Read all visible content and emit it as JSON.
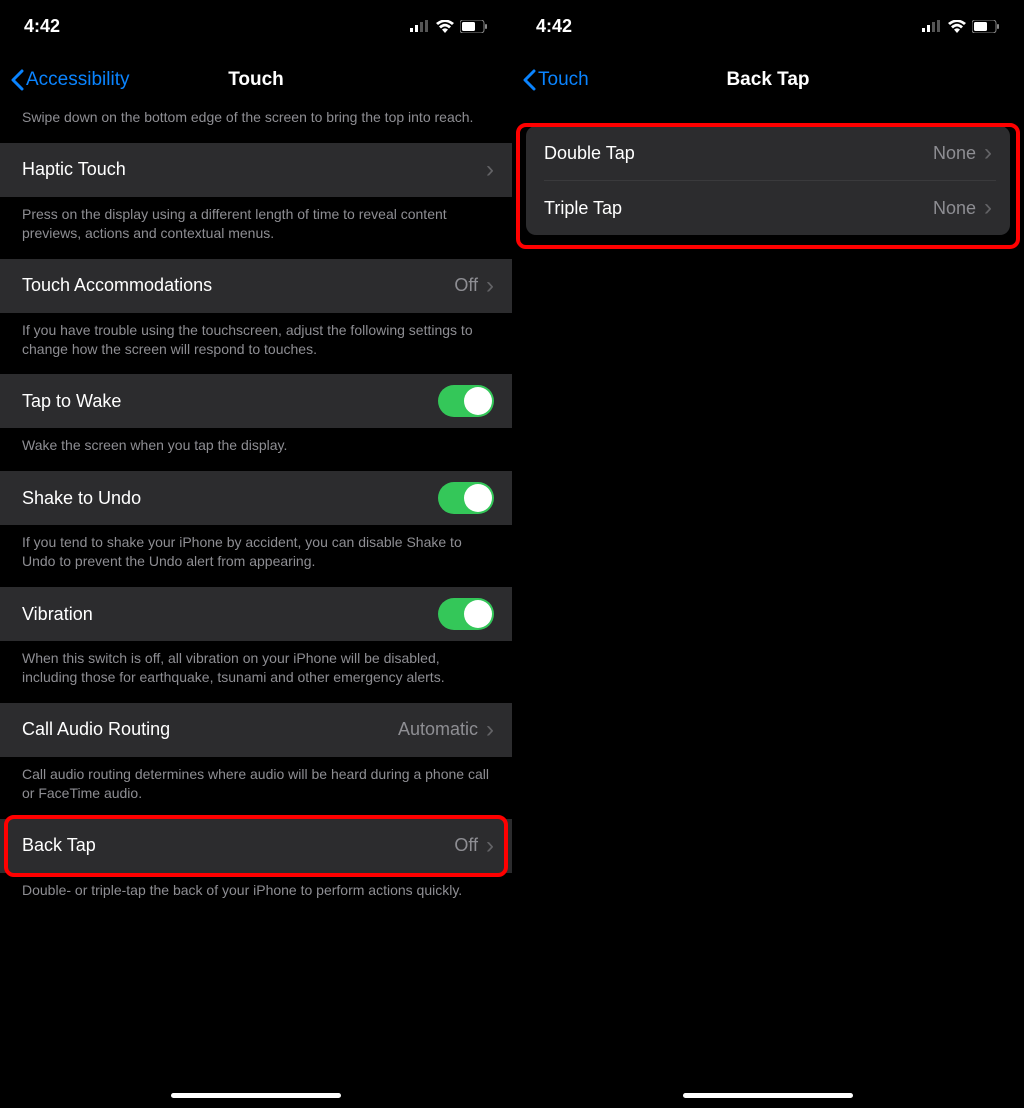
{
  "left": {
    "time": "4:42",
    "back_label": "Accessibility",
    "title": "Touch",
    "reachability_desc": "Swipe down on the bottom edge of the screen to bring the top into reach.",
    "haptic_touch": {
      "label": "Haptic Touch",
      "desc": "Press on the display using a different length of time to reveal content previews, actions and contextual menus."
    },
    "touch_accommodations": {
      "label": "Touch Accommodations",
      "value": "Off",
      "desc": "If you have trouble using the touchscreen, adjust the following settings to change how the screen will respond to touches."
    },
    "tap_to_wake": {
      "label": "Tap to Wake",
      "on": true,
      "desc": "Wake the screen when you tap the display."
    },
    "shake_to_undo": {
      "label": "Shake to Undo",
      "on": true,
      "desc": "If you tend to shake your iPhone by accident, you can disable Shake to Undo to prevent the Undo alert from appearing."
    },
    "vibration": {
      "label": "Vibration",
      "on": true,
      "desc": "When this switch is off, all vibration on your iPhone will be disabled, including those for earthquake, tsunami and other emergency alerts."
    },
    "call_audio": {
      "label": "Call Audio Routing",
      "value": "Automatic",
      "desc": "Call audio routing determines where audio will be heard during a phone call or FaceTime audio."
    },
    "back_tap": {
      "label": "Back Tap",
      "value": "Off",
      "desc": "Double- or triple-tap the back of your iPhone to perform actions quickly."
    }
  },
  "right": {
    "time": "4:42",
    "back_label": "Touch",
    "title": "Back Tap",
    "double_tap": {
      "label": "Double Tap",
      "value": "None"
    },
    "triple_tap": {
      "label": "Triple Tap",
      "value": "None"
    }
  }
}
